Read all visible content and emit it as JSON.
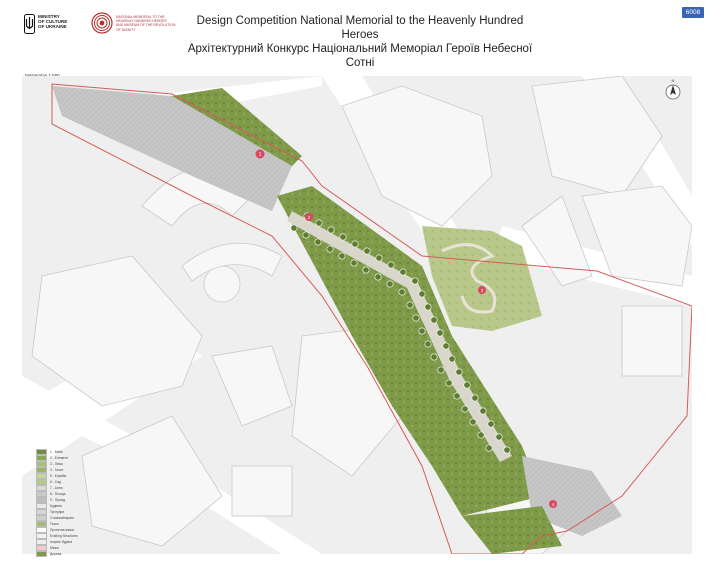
{
  "header": {
    "ministry": "MINISTRY\nOF CULTURE\nOF UKRAINE",
    "museum": "NATIONAL MEMORIAL TO THE HEAVENLY HUNDRED HEROES\nAND MUSEUM OF THE REVOLUTION OF DIGNITY",
    "title_en": "Design Competition National Memorial to the Heavenly Hundred Heroes",
    "title_ua": "Архітектурний Конкурс Національний Меморіал Героїв Небесної Сотні",
    "badge": "6008"
  },
  "map": {
    "scale_en": "Masterplan 1:500",
    "scale_ua": "Генплан 1:500",
    "markers": [
      "1",
      "2",
      "3",
      "4"
    ],
    "north": "N"
  },
  "legend": {
    "items": [
      {
        "label": "1 - Мейк",
        "color": "#6f8a45"
      },
      {
        "label": "2 - Елемент",
        "color": "#8aa65a"
      },
      {
        "label": "3 - Ліпка",
        "color": "#a8bf7a"
      },
      {
        "label": "4 - Газон",
        "color": "#9db56a"
      },
      {
        "label": "5 - Клумба",
        "color": "#c4d49a"
      },
      {
        "label": "6 - Сад",
        "color": "#b7c98a"
      },
      {
        "label": "7 - Алея",
        "color": "#d7d9cf"
      },
      {
        "label": "8 - Площа",
        "color": "#c9c9c9"
      },
      {
        "label": "9 - Прохід",
        "color": "#bdbdbd"
      },
      {
        "label": "Будівля",
        "color": "#e8e8e8"
      },
      {
        "label": "Тротуари",
        "color": "#d6d6d6"
      },
      {
        "label": "Стоянки/паркінг",
        "color": "#cfcfcf"
      },
      {
        "label": "Газон",
        "color": "#a7b87a"
      },
      {
        "label": "Проектна межа",
        "color": "#ffffff"
      },
      {
        "label": "Existing Structures",
        "color": "#f2f2f2"
      },
      {
        "label": "Існуючі будівлі",
        "color": "#eeeeee"
      },
      {
        "label": "Межа",
        "color": "#f3c9c9"
      },
      {
        "label": "Дерева",
        "color": "#7d9a4f"
      }
    ]
  },
  "colors": {
    "boundary": "#d55b5b",
    "marker": "#d9485f",
    "green": "#6f8d3e",
    "paving": "#bfbfbf",
    "building": "#f4f4f4",
    "badge": "#3b64b4"
  }
}
